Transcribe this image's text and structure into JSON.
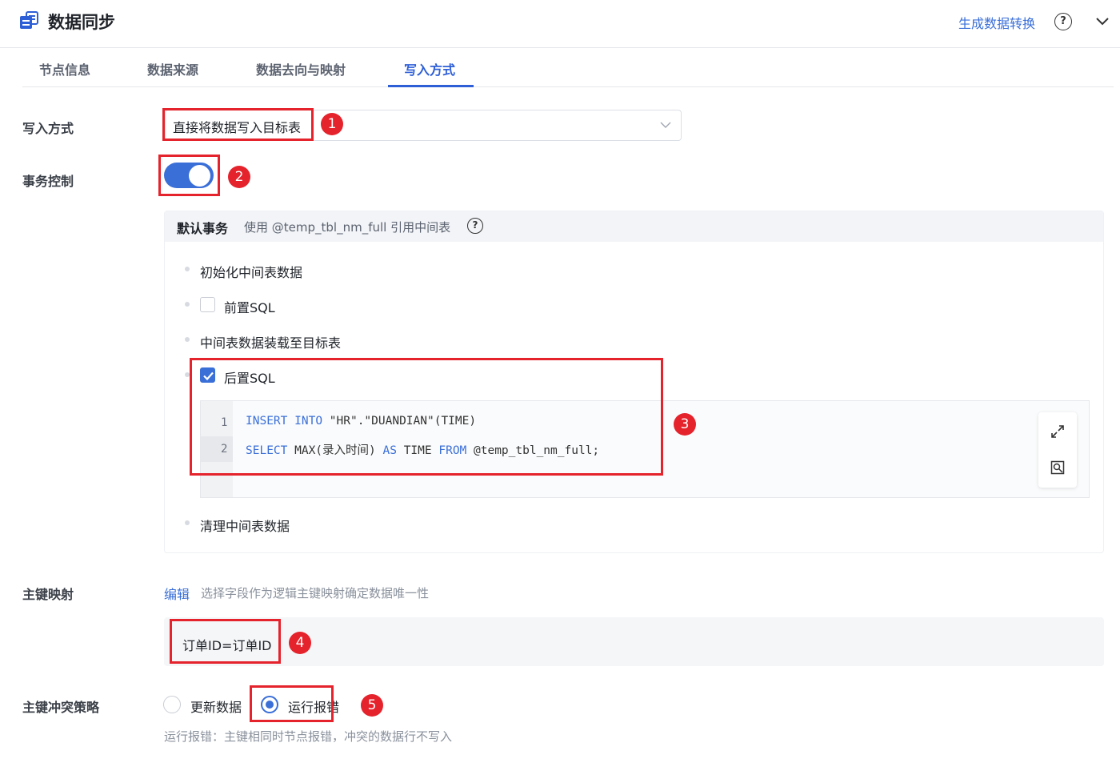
{
  "header": {
    "title": "数据同步",
    "generate_link": "生成数据转换",
    "help_glyph": "?"
  },
  "tabs": [
    {
      "label": "节点信息",
      "active": false
    },
    {
      "label": "数据来源",
      "active": false
    },
    {
      "label": "数据去向与映射",
      "active": false
    },
    {
      "label": "写入方式",
      "active": true
    }
  ],
  "write_mode": {
    "label": "写入方式",
    "value": "直接将数据写入目标表"
  },
  "transaction": {
    "label": "事务控制",
    "enabled": true,
    "panel_title": "默认事务",
    "panel_desc": "使用 @temp_tbl_nm_full 引用中间表",
    "steps": {
      "init": "初始化中间表数据",
      "pre_sql": "前置SQL",
      "load": "中间表数据装载至目标表",
      "post_sql": "后置SQL",
      "clean": "清理中间表数据"
    },
    "pre_sql_checked": false,
    "post_sql_checked": true,
    "code": {
      "line_numbers": [
        "1",
        "2"
      ],
      "line1": {
        "k1": "INSERT",
        "k2": "INTO",
        "rest": " \"HR\".\"DUANDIAN\"(TIME)"
      },
      "line2": {
        "k1": "SELECT",
        "mid": " MAX(录入时间) ",
        "k2": "AS",
        "mid2": " TIME ",
        "k3": "FROM",
        "rest": " @temp_tbl_nm_full;"
      }
    }
  },
  "pk_mapping": {
    "label": "主键映射",
    "edit_link": "编辑",
    "desc": "选择字段作为逻辑主键映射确定数据唯一性",
    "value": "订单ID=订单ID"
  },
  "pk_conflict": {
    "label": "主键冲突策略",
    "options": [
      {
        "label": "更新数据",
        "selected": false
      },
      {
        "label": "运行报错",
        "selected": true
      }
    ],
    "hint": "运行报错：主键相同时节点报错，冲突的数据行不写入"
  },
  "annotations": [
    "1",
    "2",
    "3",
    "4",
    "5"
  ],
  "colors": {
    "accent": "#3a6fd8",
    "annotation_red": "#e5232c"
  }
}
